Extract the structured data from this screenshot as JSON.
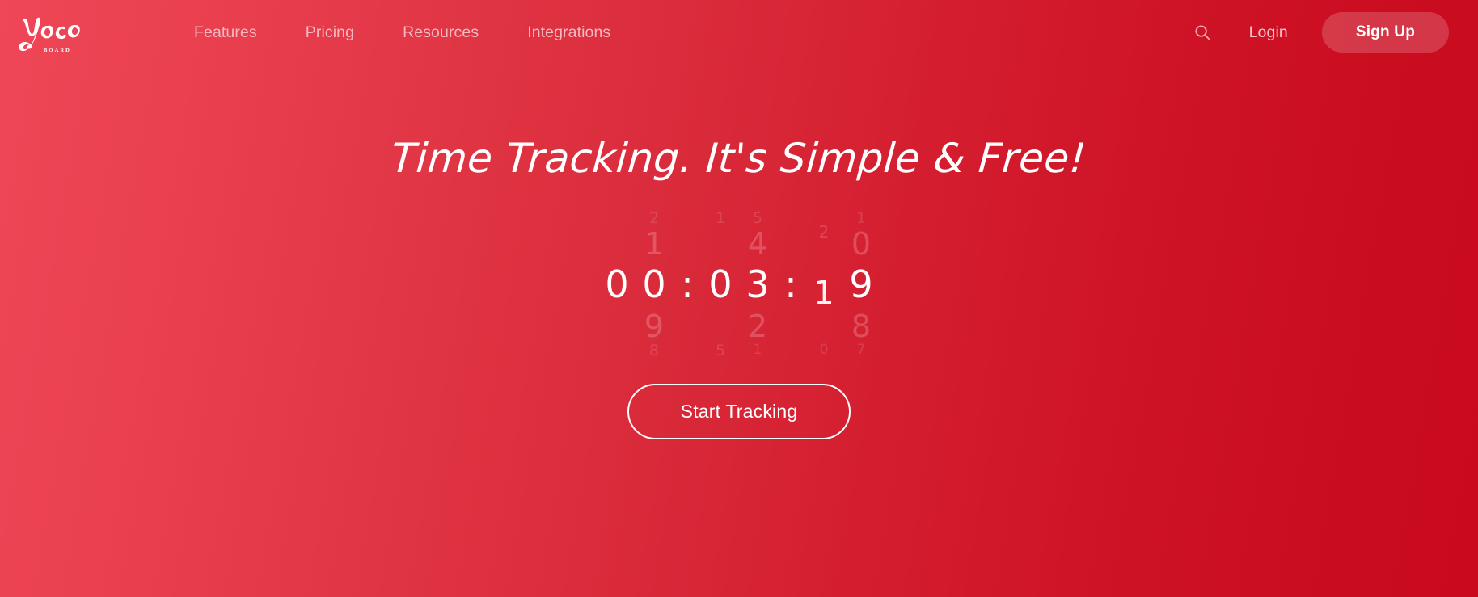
{
  "brand": {
    "name": "Yoco",
    "subtitle": "BOARD"
  },
  "nav": {
    "items": [
      {
        "label": "Features"
      },
      {
        "label": "Pricing"
      },
      {
        "label": "Resources"
      },
      {
        "label": "Integrations"
      }
    ]
  },
  "header_right": {
    "search_icon": "search-icon",
    "login_label": "Login",
    "signup_label": "Sign Up"
  },
  "hero": {
    "headline": "Time Tracking. It's Simple & Free!",
    "cta_label": "Start Tracking"
  },
  "timer": {
    "display": "00 : 03 : 19",
    "hours": "00",
    "minutes": "03",
    "seconds": "19",
    "separator": ":",
    "columns": [
      {
        "name": "hours-tens",
        "far_up": "",
        "up": "",
        "center": "0",
        "down": "",
        "far_down": ""
      },
      {
        "name": "hours-ones",
        "far_up": "2",
        "up": "1",
        "center": "0",
        "down": "9",
        "far_down": "8"
      },
      {
        "name": "minutes-tens",
        "far_up": "1",
        "up": "",
        "center": "0",
        "down": "",
        "far_down": "5"
      },
      {
        "name": "minutes-ones",
        "far_up": "5",
        "up": "4",
        "center": "3",
        "down": "2",
        "far_down": "1"
      },
      {
        "name": "seconds-tens",
        "far_up": "",
        "up": "2",
        "center": "1",
        "down": "",
        "far_down": "0"
      },
      {
        "name": "seconds-ones",
        "far_up": "1",
        "up": "0",
        "center": "9",
        "down": "8",
        "far_down": "7"
      }
    ]
  },
  "colors": {
    "bg_gradient_start": "#ef4757",
    "bg_gradient_mid": "#dd2538",
    "bg_gradient_end": "#c90a1e",
    "nav_text": "#f7b9bf",
    "text_on_brand": "#ffffff",
    "signup_pill": "rgba(255,255,255,0.18)"
  }
}
